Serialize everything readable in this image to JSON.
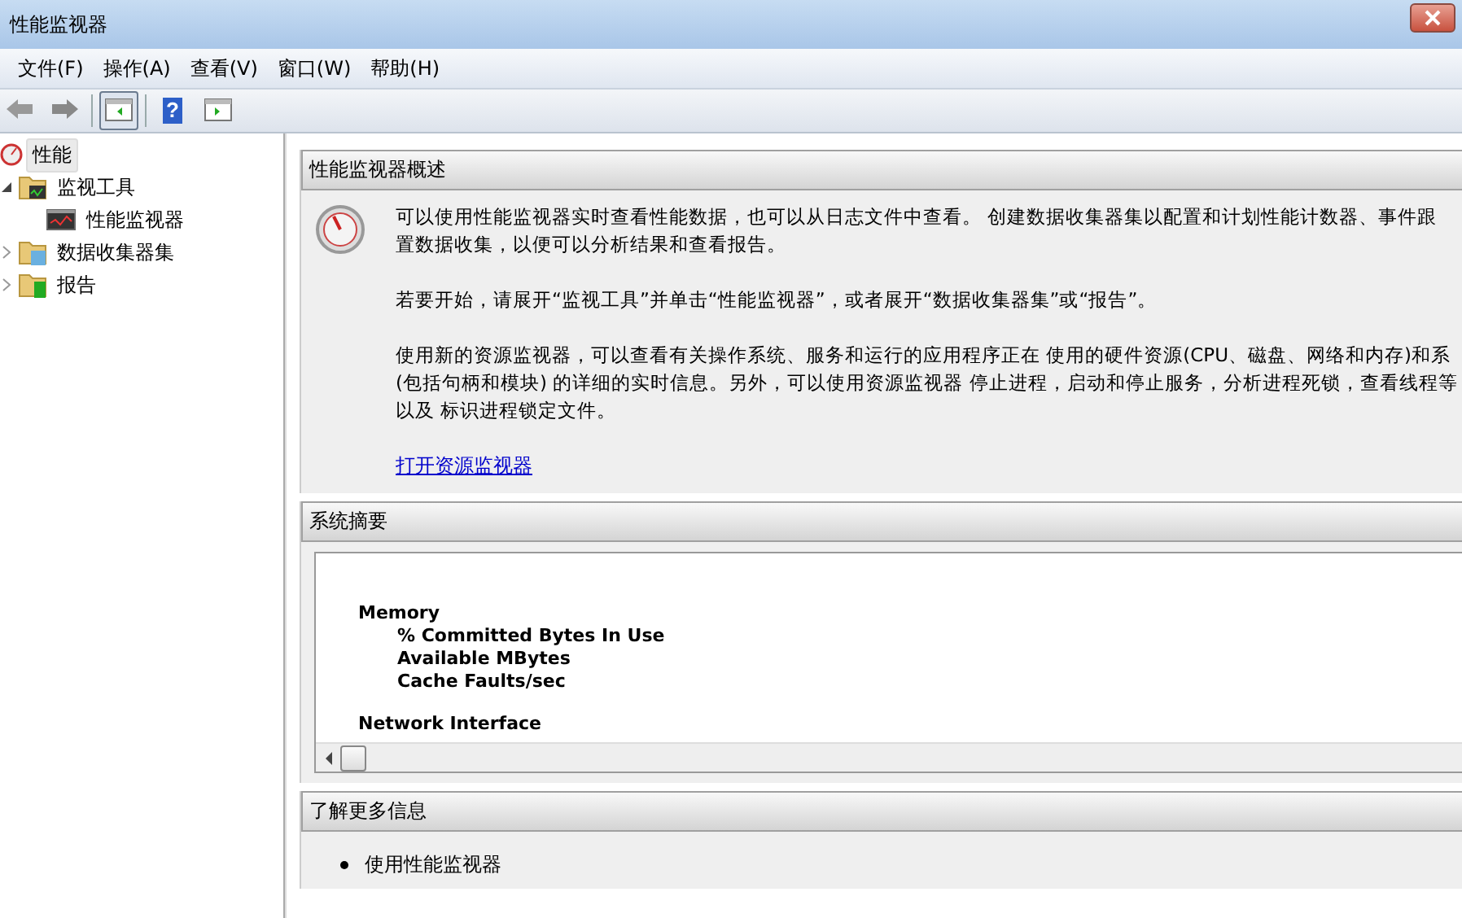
{
  "window": {
    "title": "性能监视器"
  },
  "menu": [
    {
      "label": "文件(F)"
    },
    {
      "label": "操作(A)"
    },
    {
      "label": "查看(V)"
    },
    {
      "label": "窗口(W)"
    },
    {
      "label": "帮助(H)"
    }
  ],
  "toolbar": [
    {
      "kind": "back",
      "selected": false
    },
    {
      "kind": "forward",
      "selected": false
    },
    {
      "kind": "pane",
      "selected": true
    },
    {
      "kind": "help",
      "label": "?",
      "selected": false
    },
    {
      "kind": "pane2",
      "selected": false
    }
  ],
  "tree": {
    "label": "性能",
    "selected": true,
    "children": [
      {
        "label": "监视工具",
        "expanded": true,
        "kind": "monitor",
        "children": [
          {
            "label": "性能监视器",
            "kind": "graph"
          }
        ]
      },
      {
        "label": "数据收集器集",
        "expanded": false,
        "kind": "collector"
      },
      {
        "label": "报告",
        "expanded": false,
        "kind": "report"
      }
    ]
  },
  "overview": {
    "title": "性能监视器概述",
    "paragraphs": [
      [
        "可以使用性能监视器实时查看性能数据，也可以从日志文件中查看。 创建数据收集器集以配置和计划性能计数器、事件跟",
        "置数据收集，以便可以分析结果和查看报告。"
      ],
      [
        "若要开始，请展开“监视工具”并单击“性能监视器”，或者展开“数据收集器集”或“报告”。"
      ],
      [
        "使用新的资源监视器，可以查看有关操作系统、服务和运行的应用程序正在 使用的硬件资源(CPU、磁盘、网络和内存)和系",
        "(包括句柄和模块) 的详细的实时信息。另外，可以使用资源监视器 停止进程，启动和停止服务，分析进程死锁，查看线程等",
        "以及 标识进程锁定文件。"
      ]
    ],
    "link": "打开资源监视器"
  },
  "summary": {
    "title": "系统摘要",
    "groups": [
      {
        "name": "Memory",
        "counters": [
          "% Committed Bytes In Use",
          "Available MBytes",
          "Cache Faults/sec"
        ]
      },
      {
        "name": "Network Interface"
      }
    ]
  },
  "more": {
    "title": "了解更多信息",
    "items": [
      "使用性能监视器"
    ]
  }
}
